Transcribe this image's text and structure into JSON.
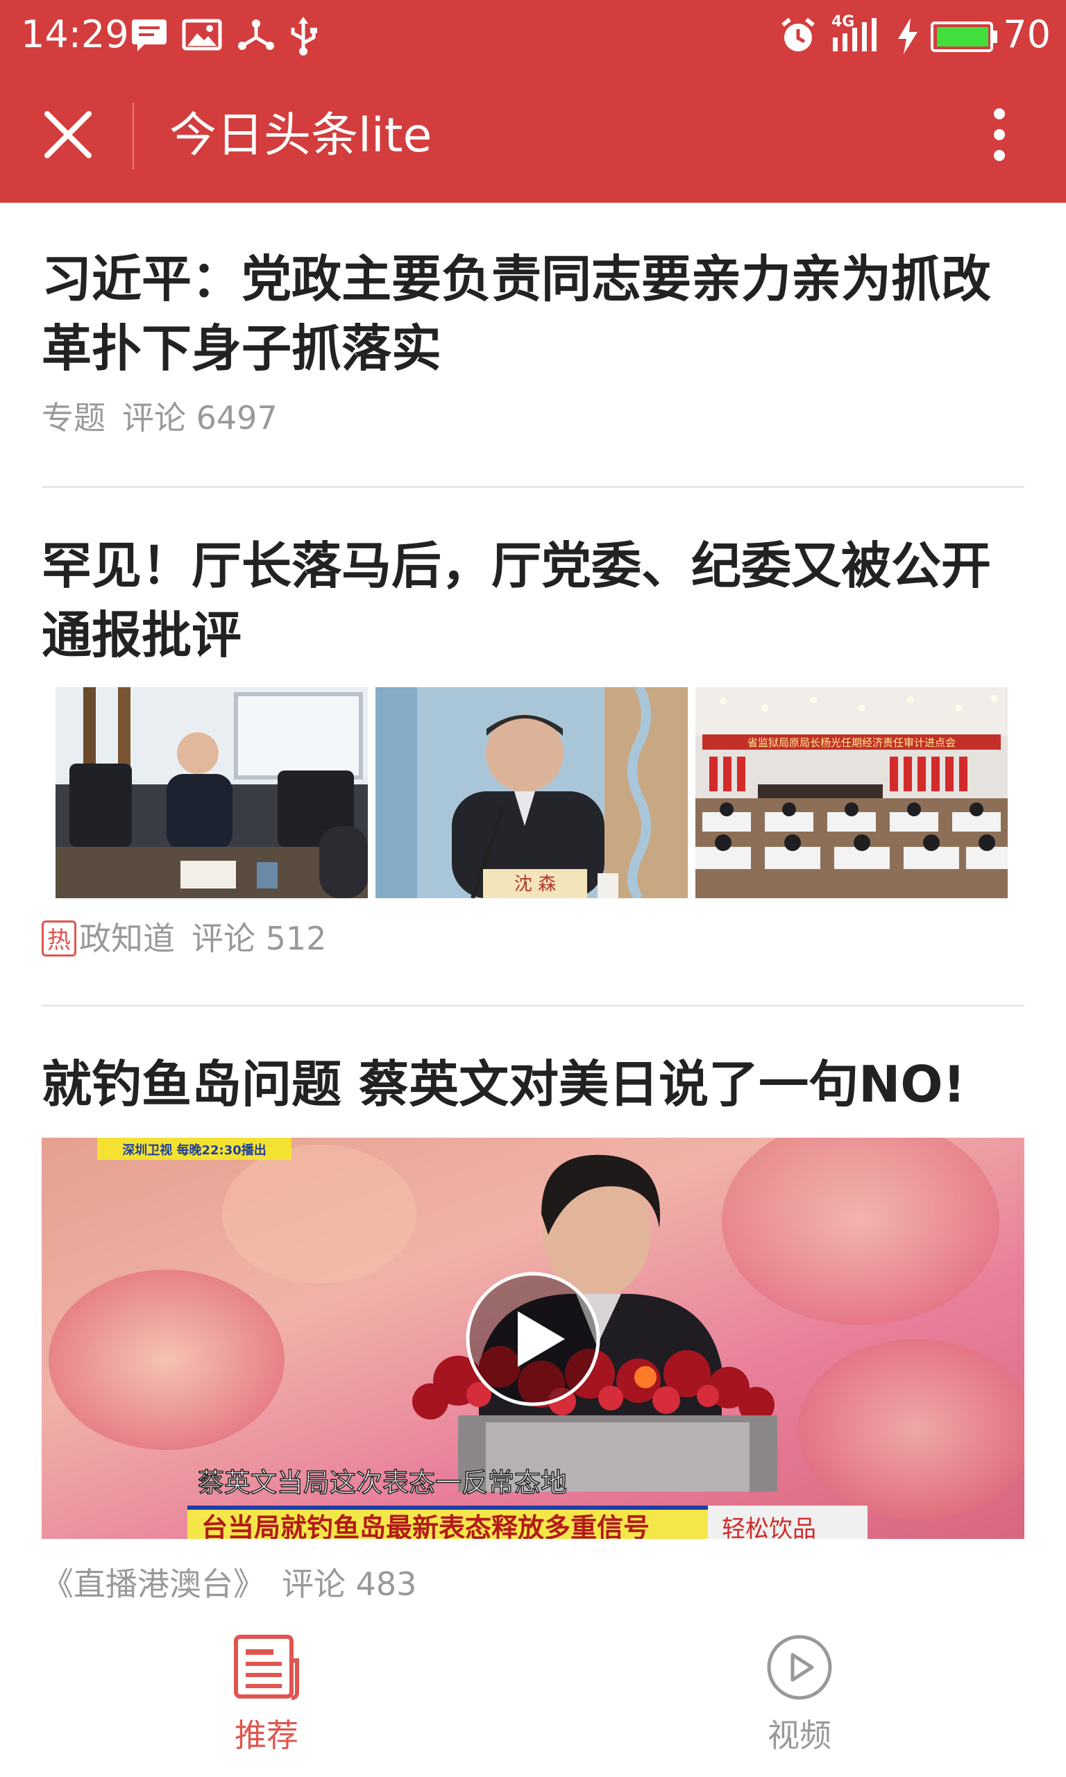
{
  "status_bar": {
    "time": "14:29",
    "network": "4G",
    "battery": "70",
    "icons": [
      "message-icon",
      "image-icon",
      "share-icon",
      "usb-icon",
      "alarm-icon",
      "signal-icon",
      "charging-icon",
      "battery-icon"
    ]
  },
  "nav": {
    "title": "今日头条lite",
    "close_icon": "close-icon",
    "menu_icon": "more-vertical-icon"
  },
  "articles": [
    {
      "title": "习近平：党政主要负责同志要亲力亲为抓改革扑下身子抓落实",
      "source": "专题",
      "comments": "评论 6497"
    },
    {
      "title": "罕见！厅长落马后，厅党委、纪委又被公开通报批评",
      "hot_tag": "热",
      "source": "政知道",
      "comments": "评论 512",
      "images": [
        "photo-official-at-table",
        "photo-official-at-microphone",
        "photo-conference-hall"
      ],
      "nameplate": "沈 森",
      "banner": "省监狱局原局长杨光任期经济责任审计进点会"
    },
    {
      "title": "就钓鱼岛问题 蔡英文对美日说了一句NO!",
      "source": "《直播港澳台》",
      "comments": "评论 483",
      "video": {
        "channel_badge": "深圳卫视 每晚22:30播出",
        "subtitle": "蔡英文当局这次表态一反常态地",
        "ticker": "台当局就钓鱼岛最新表态释放多重信号",
        "ticker_tag": "轻松饮品",
        "play_icon": "play-icon"
      }
    }
  ],
  "tabbar": {
    "items": [
      {
        "label": "推荐",
        "icon": "news-icon",
        "active": true
      },
      {
        "label": "视频",
        "icon": "video-play-icon",
        "active": false
      }
    ]
  },
  "colors": {
    "brand_red": "#d43d3d",
    "active_tab": "#e0554f",
    "inactive_tab": "#999999"
  }
}
